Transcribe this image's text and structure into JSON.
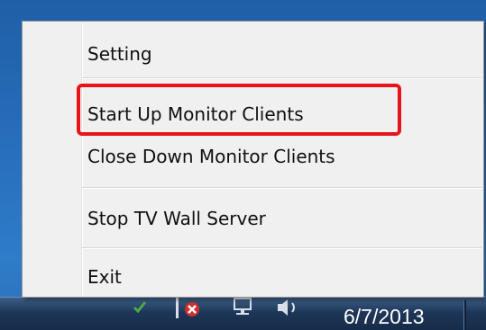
{
  "context_menu": {
    "items": [
      {
        "label": "Setting"
      },
      {
        "label": "Start Up Monitor Clients"
      },
      {
        "label": "Close Down Monitor Clients"
      },
      {
        "label": "Stop TV Wall Server"
      },
      {
        "label": "Exit"
      }
    ],
    "highlighted_item": "Start Up Monitor Clients",
    "highlight_color": "#e8141c"
  },
  "taskbar": {
    "clock": {
      "date": "6/7/2013"
    },
    "tray_icons": [
      "shield-check-icon",
      "flag-error-icon",
      "network-icon",
      "speaker-icon"
    ]
  }
}
